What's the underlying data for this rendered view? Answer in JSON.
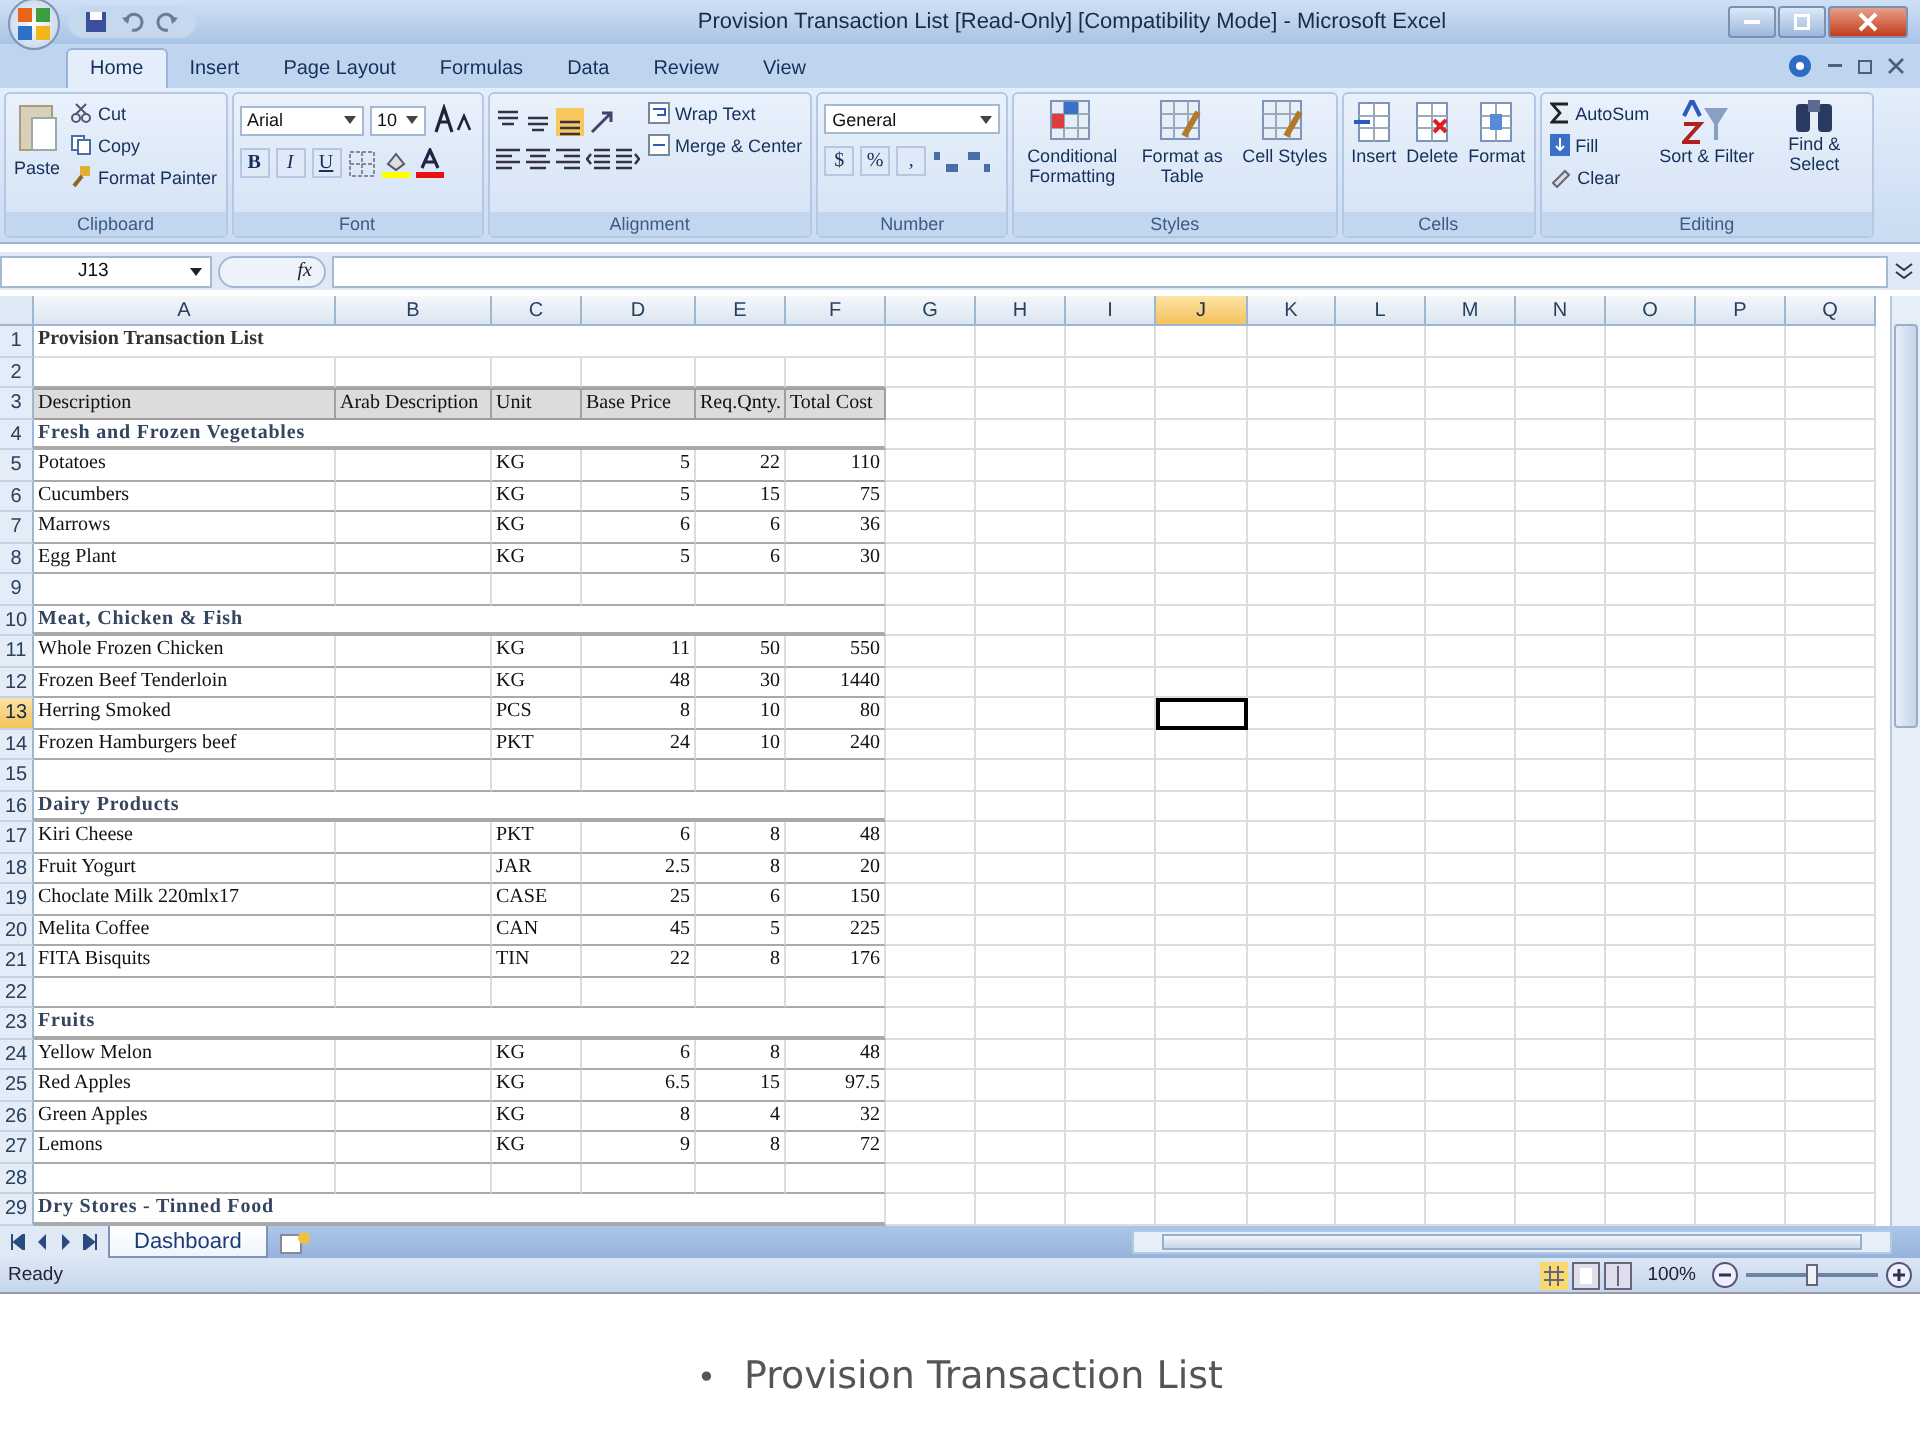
{
  "window": {
    "title": "Provision Transaction List  [Read-Only]  [Compatibility Mode] - Microsoft Excel"
  },
  "ribbon_tabs": [
    {
      "label": "Home",
      "selected": true
    },
    {
      "label": "Insert",
      "selected": false
    },
    {
      "label": "Page Layout",
      "selected": false
    },
    {
      "label": "Formulas",
      "selected": false
    },
    {
      "label": "Data",
      "selected": false
    },
    {
      "label": "Review",
      "selected": false
    },
    {
      "label": "View",
      "selected": false
    }
  ],
  "clipboard": {
    "label": "Clipboard",
    "paste": "Paste",
    "cut": "Cut",
    "copy": "Copy",
    "format_painter": "Format Painter"
  },
  "font": {
    "label": "Font",
    "font_name": "Arial",
    "font_size": "10",
    "bold": "B",
    "italic": "I",
    "underline": "U"
  },
  "alignment": {
    "label": "Alignment",
    "wrap": "Wrap Text",
    "merge": "Merge & Center"
  },
  "number": {
    "label": "Number",
    "format": "General",
    "currency": "$",
    "percent": "%",
    "comma": ","
  },
  "styles": {
    "label": "Styles",
    "buttons": [
      "Conditional Formatting",
      "Format as Table",
      "Cell Styles"
    ]
  },
  "cells": {
    "label": "Cells",
    "buttons": [
      "Insert",
      "Delete",
      "Format"
    ]
  },
  "editing": {
    "label": "Editing",
    "autosum": "AutoSum",
    "fill": "Fill",
    "clear": "Clear",
    "sort": "Sort & Filter",
    "find": "Find & Select"
  },
  "formula_bar": {
    "name_box": "J13",
    "fx": "fx"
  },
  "columns": [
    {
      "letter": "A",
      "selected": false
    },
    {
      "letter": "B",
      "selected": false
    },
    {
      "letter": "C",
      "selected": false
    },
    {
      "letter": "D",
      "selected": false
    },
    {
      "letter": "E",
      "selected": false
    },
    {
      "letter": "F",
      "selected": false
    },
    {
      "letter": "G",
      "selected": false
    },
    {
      "letter": "H",
      "selected": false
    },
    {
      "letter": "I",
      "selected": false
    },
    {
      "letter": "J",
      "selected": true
    },
    {
      "letter": "K",
      "selected": false
    },
    {
      "letter": "L",
      "selected": false
    },
    {
      "letter": "M",
      "selected": false
    },
    {
      "letter": "N",
      "selected": false
    },
    {
      "letter": "O",
      "selected": false
    },
    {
      "letter": "P",
      "selected": false
    },
    {
      "letter": "Q",
      "selected": false
    }
  ],
  "rows": [
    {
      "num": "1",
      "kind": "title",
      "selected": false,
      "text": "Provision Transaction List"
    },
    {
      "num": "2",
      "kind": "blank",
      "selected": false
    },
    {
      "num": "3",
      "kind": "header",
      "selected": false,
      "headers": [
        "Description",
        "Arab Description",
        "Unit",
        "Base Price",
        "Req.Qnty.",
        "Total Cost"
      ]
    },
    {
      "num": "4",
      "kind": "section",
      "selected": false,
      "text": "Fresh and Frozen Vegetables"
    },
    {
      "num": "5",
      "kind": "item",
      "selected": false,
      "description": "Potatoes",
      "unit": "KG",
      "price": "5",
      "qty": "22",
      "total": "110"
    },
    {
      "num": "6",
      "kind": "item",
      "selected": false,
      "description": "Cucumbers",
      "unit": "KG",
      "price": "5",
      "qty": "15",
      "total": "75"
    },
    {
      "num": "7",
      "kind": "item",
      "selected": false,
      "description": "Marrows",
      "unit": "KG",
      "price": "6",
      "qty": "6",
      "total": "36"
    },
    {
      "num": "8",
      "kind": "item",
      "selected": false,
      "description": "Egg Plant",
      "unit": "KG",
      "price": "5",
      "qty": "6",
      "total": "30"
    },
    {
      "num": "9",
      "kind": "blank",
      "selected": false
    },
    {
      "num": "10",
      "kind": "section",
      "selected": false,
      "text": "Meat, Chicken & Fish"
    },
    {
      "num": "11",
      "kind": "item",
      "selected": false,
      "description": "Whole Frozen Chicken",
      "unit": "KG",
      "price": "11",
      "qty": "50",
      "total": "550"
    },
    {
      "num": "12",
      "kind": "item",
      "selected": false,
      "description": "Frozen Beef Tenderloin",
      "unit": "KG",
      "price": "48",
      "qty": "30",
      "total": "1440"
    },
    {
      "num": "13",
      "kind": "item",
      "selected": true,
      "description": "Herring Smoked",
      "unit": "PCS",
      "price": "8",
      "qty": "10",
      "total": "80"
    },
    {
      "num": "14",
      "kind": "item",
      "selected": false,
      "description": "Frozen Hamburgers beef",
      "unit": "PKT",
      "price": "24",
      "qty": "10",
      "total": "240"
    },
    {
      "num": "15",
      "kind": "blank",
      "selected": false
    },
    {
      "num": "16",
      "kind": "section",
      "selected": false,
      "text": "Dairy  Products"
    },
    {
      "num": "17",
      "kind": "item",
      "selected": false,
      "description": "Kiri Cheese",
      "unit": "PKT",
      "price": "6",
      "qty": "8",
      "total": "48"
    },
    {
      "num": "18",
      "kind": "item",
      "selected": false,
      "description": "Fruit Yogurt",
      "unit": "JAR",
      "price": "2.5",
      "qty": "8",
      "total": "20"
    },
    {
      "num": "19",
      "kind": "item",
      "selected": false,
      "description": "Choclate Milk  220mlx17",
      "unit": "CASE",
      "price": "25",
      "qty": "6",
      "total": "150"
    },
    {
      "num": "20",
      "kind": "item",
      "selected": false,
      "description": "Melita Coffee",
      "unit": "CAN",
      "price": "45",
      "qty": "5",
      "total": "225"
    },
    {
      "num": "21",
      "kind": "item",
      "selected": false,
      "description": "FITA Bisquits",
      "unit": "TIN",
      "price": "22",
      "qty": "8",
      "total": "176"
    },
    {
      "num": "22",
      "kind": "blank",
      "selected": false
    },
    {
      "num": "23",
      "kind": "section",
      "selected": false,
      "text": "Fruits"
    },
    {
      "num": "24",
      "kind": "item",
      "selected": false,
      "description": "Yellow Melon",
      "unit": "KG",
      "price": "6",
      "qty": "8",
      "total": "48"
    },
    {
      "num": "25",
      "kind": "item",
      "selected": false,
      "description": "Red Apples",
      "unit": "KG",
      "price": "6.5",
      "qty": "15",
      "total": "97.5"
    },
    {
      "num": "26",
      "kind": "item",
      "selected": false,
      "description": "Green Apples",
      "unit": "KG",
      "price": "8",
      "qty": "4",
      "total": "32"
    },
    {
      "num": "27",
      "kind": "item",
      "selected": false,
      "description": "Lemons",
      "unit": "KG",
      "price": "9",
      "qty": "8",
      "total": "72"
    },
    {
      "num": "28",
      "kind": "blank",
      "selected": false
    },
    {
      "num": "29",
      "kind": "section",
      "selected": false,
      "text": "Dry  Stores - Tinned Food"
    }
  ],
  "sheet_tabs": [
    {
      "label": "Dashboard",
      "selected": true
    }
  ],
  "status_bar": {
    "status": "Ready",
    "zoom": "100%",
    "zoom_slider": {
      "level": 0.5
    }
  },
  "caption": {
    "bullet": "•",
    "text": "Provision Transaction List"
  }
}
